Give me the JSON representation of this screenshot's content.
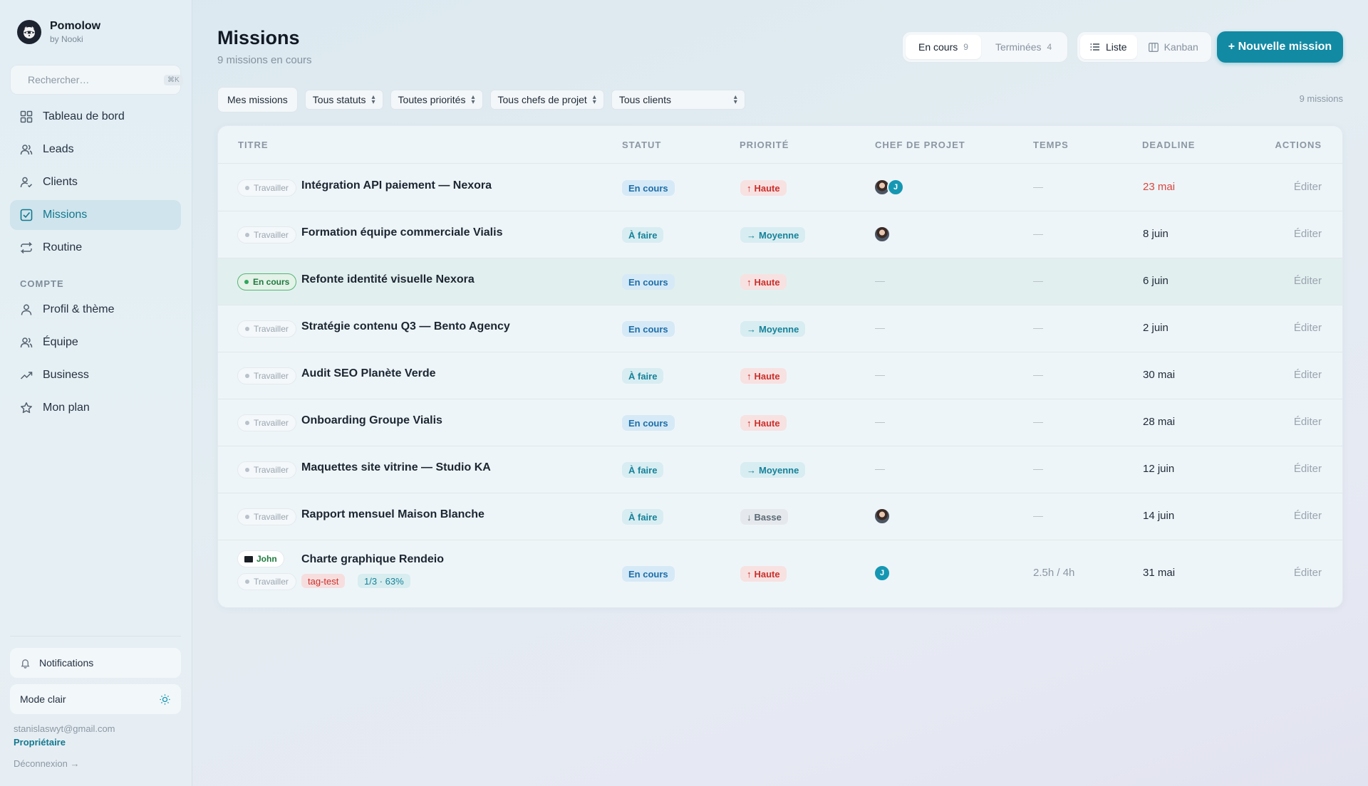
{
  "brand": {
    "name": "Pomolow",
    "subtitle": "by Nooki"
  },
  "search": {
    "placeholder": "Rechercher…",
    "shortcut": "⌘K"
  },
  "nav": {
    "main": [
      {
        "label": "Tableau de bord",
        "icon": "dashboard-icon"
      },
      {
        "label": "Leads",
        "icon": "users-icon"
      },
      {
        "label": "Clients",
        "icon": "user-check-icon"
      },
      {
        "label": "Missions",
        "icon": "checkbox-icon",
        "active": true
      },
      {
        "label": "Routine",
        "icon": "repeat-icon"
      }
    ],
    "section_label": "COMPTE",
    "account": [
      {
        "label": "Profil & thème",
        "icon": "user-icon"
      },
      {
        "label": "Équipe",
        "icon": "team-icon"
      },
      {
        "label": "Business",
        "icon": "trending-icon"
      },
      {
        "label": "Mon plan",
        "icon": "star-icon"
      }
    ]
  },
  "footer": {
    "notifications": "Notifications",
    "theme_mode": "Mode clair",
    "email": "stanislaswyt@gmail.com",
    "role": "Propriétaire",
    "logout": "Déconnexion →"
  },
  "header": {
    "title": "Missions",
    "subtitle": "9 missions en cours",
    "status_tabs": [
      {
        "label": "En cours",
        "count": "9",
        "selected": true
      },
      {
        "label": "Terminées",
        "count": "4",
        "selected": false
      }
    ],
    "view_tabs": [
      {
        "label": "Liste",
        "selected": true
      },
      {
        "label": "Kanban",
        "selected": false
      }
    ],
    "new_button": "+ Nouvelle mission"
  },
  "filters": {
    "mine": "Mes missions",
    "status": "Tous statuts",
    "priority": "Toutes priorités",
    "managers": "Tous chefs de projet",
    "clients": "Tous clients",
    "count": "9 missions"
  },
  "table": {
    "columns": [
      "TITRE",
      "STATUT",
      "PRIORITÉ",
      "CHEF DE PROJET",
      "TEMPS",
      "DEADLINE",
      "ACTIONS"
    ],
    "rows": [
      {
        "tag": "Travailler",
        "title": "Intégration API paiement — Nexora",
        "status": "En cours",
        "priority": "Haute",
        "priority_symbol": "↑",
        "managers": [
          "photo",
          "J"
        ],
        "time": "—",
        "deadline": "23 mai",
        "deadline_late": true,
        "action": "Éditer"
      },
      {
        "tag": "Travailler",
        "title": "Formation équipe commerciale Vialis",
        "status": "À faire",
        "priority": "Moyenne",
        "priority_symbol": "→",
        "managers": [
          "photo"
        ],
        "time": "—",
        "deadline": "8 juin",
        "deadline_late": false,
        "action": "Éditer"
      },
      {
        "tag": "En cours",
        "tag_active": true,
        "title": "Refonte identité visuelle Nexora",
        "status": "En cours",
        "priority": "Haute",
        "priority_symbol": "↑",
        "managers": [],
        "manager_placeholder": "—",
        "time": "—",
        "deadline": "6 juin",
        "deadline_late": false,
        "action": "Éditer"
      },
      {
        "tag": "Travailler",
        "title": "Stratégie contenu Q3 — Bento Agency",
        "status": "En cours",
        "priority": "Moyenne",
        "priority_symbol": "→",
        "managers": [],
        "manager_placeholder": "—",
        "time": "—",
        "deadline": "2 juin",
        "deadline_late": false,
        "action": "Éditer"
      },
      {
        "tag": "Travailler",
        "title": "Audit SEO Planète Verde",
        "status": "À faire",
        "priority": "Haute",
        "priority_symbol": "↑",
        "managers": [],
        "manager_placeholder": "—",
        "time": "—",
        "deadline": "30 mai",
        "deadline_late": false,
        "action": "Éditer"
      },
      {
        "tag": "Travailler",
        "title": "Onboarding Groupe Vialis",
        "status": "En cours",
        "priority": "Haute",
        "priority_symbol": "↑",
        "managers": [],
        "manager_placeholder": "—",
        "time": "—",
        "deadline": "28 mai",
        "deadline_late": false,
        "action": "Éditer"
      },
      {
        "tag": "Travailler",
        "title": "Maquettes site vitrine — Studio KA",
        "status": "À faire",
        "priority": "Moyenne",
        "priority_symbol": "→",
        "managers": [],
        "manager_placeholder": "—",
        "time": "—",
        "deadline": "12 juin",
        "deadline_late": false,
        "action": "Éditer"
      },
      {
        "tag": "Travailler",
        "title": "Rapport mensuel Maison Blanche",
        "status": "À faire",
        "priority": "Basse",
        "priority_symbol": "↓",
        "managers": [
          "photo"
        ],
        "time": "—",
        "deadline": "14 juin",
        "deadline_late": false,
        "action": "Éditer"
      },
      {
        "tag": "Travailler",
        "user_tag": "John",
        "title": "Charte graphique Rendeio",
        "sub_tags": [
          "tag-test",
          "1/3 · 63%"
        ],
        "status": "En cours",
        "priority": "Haute",
        "priority_symbol": "↑",
        "managers": [
          "J"
        ],
        "time": "2.5h / 4h",
        "deadline": "31 mai",
        "deadline_late": false,
        "action": "Éditer"
      }
    ]
  },
  "colors": {
    "accent": "#128aa4",
    "active_nav_bg": "#cfe4ec",
    "late_deadline": "#d9463f",
    "high_priority": "#c9302c"
  }
}
